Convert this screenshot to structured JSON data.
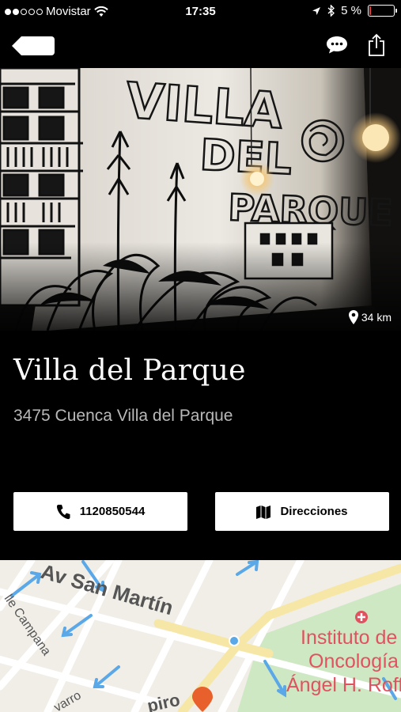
{
  "status_bar": {
    "carrier": "Movistar",
    "time": "17:35",
    "battery": "5 %",
    "battery_level": 0.05,
    "signal_bars_filled": 2,
    "signal_bars_total": 5
  },
  "nav": {
    "back_icon": "back-arrow-icon",
    "chat_icon": "chat-bubble-icon",
    "share_icon": "share-icon"
  },
  "hero": {
    "mural_text_line1": "VILLA",
    "mural_text_line2": "DEL",
    "mural_text_line3": "PARQUE",
    "distance": "34 km"
  },
  "place": {
    "title": "Villa del Parque",
    "address": "3475 Cuenca Villa del Parque"
  },
  "actions": {
    "phone_label": "1120850544",
    "directions_label": "Direcciones"
  },
  "map": {
    "street_main": "Av San Martín",
    "street_side": "lle Campana",
    "street_lower": "varro",
    "street_bottom": "piro",
    "poi_line1": "Instituto de",
    "poi_line2": "Oncología",
    "poi_line3": "Ángel H. Roffo",
    "pin_color": "#e8612c",
    "poi_color": "#e0525f",
    "park_color": "#cfe8c4"
  },
  "colors": {
    "background": "#000000",
    "address_text": "#b8b8b8",
    "battery_low": "#e53935"
  }
}
